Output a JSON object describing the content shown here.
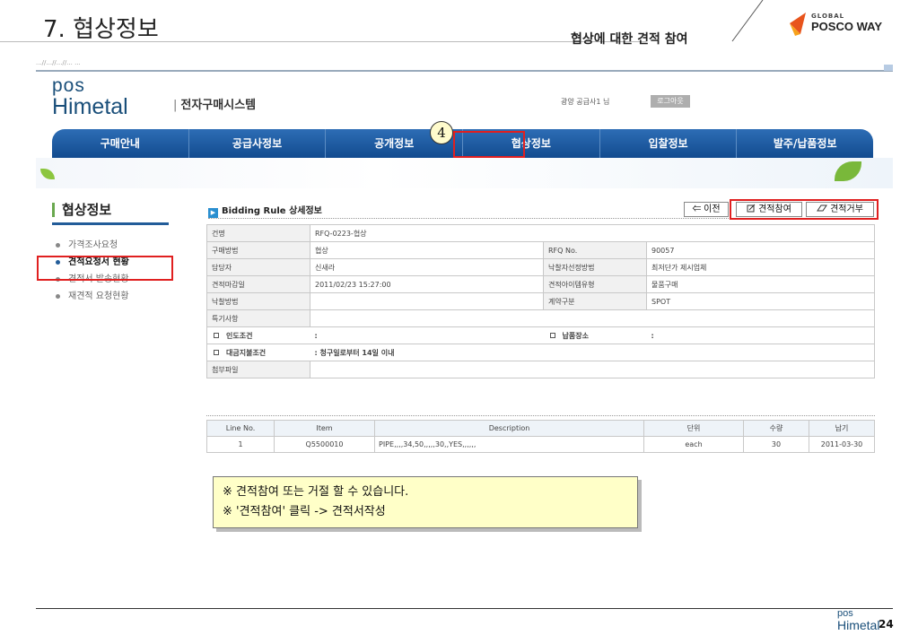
{
  "slide": {
    "title": "7. 협상정보",
    "subtitle": "협상에 대한 견적 참여",
    "brand_global": "GLOBAL",
    "brand_name": "POSCO WAY",
    "page_number": "24",
    "step_badge": "4"
  },
  "url_strip": "...//...//...//... ...",
  "site": {
    "logo_pos": "pos",
    "logo_himetal": "Himetal",
    "system_name": "전자구매시스템",
    "system_bar": "|",
    "user_label": "광양 공급사1 님",
    "logout_label": "로그아웃"
  },
  "nav": {
    "items": [
      "구매안내",
      "공급사정보",
      "공개정보",
      "협상정보",
      "입찰정보",
      "발주/납품정보"
    ],
    "active_index": 3
  },
  "sidebar": {
    "title": "협상정보",
    "items": [
      "가격조사요청",
      "견적요청서 현황",
      "견적서 발송현황",
      "재견적 요청현황"
    ],
    "active_index": 1
  },
  "content": {
    "title": "Bidding Rule 상세정보",
    "title_icon": "▶",
    "buttons": {
      "prev": "⇐ 이전",
      "join": "견적참여",
      "reject": "견적거부"
    },
    "info": {
      "name_label": "건명",
      "name_value": "RFQ-0223-협상",
      "purchase_method_label": "구매방법",
      "purchase_method_value": "협상",
      "rfq_no_label": "RFQ No.",
      "rfq_no_value": "90057",
      "manager_label": "담당자",
      "manager_value": "신새라",
      "award_method_label": "낙찰자선정방법",
      "award_method_value": "최저단가 제시업체",
      "deadline_label": "견적마감일",
      "deadline_value": "2011/02/23 15:27:00",
      "item_type_label": "견적아이템유형",
      "item_type_value": "물품구매",
      "bid_method_label": "낙찰방법",
      "bid_method_value": "",
      "contract_type_label": "계약구분",
      "contract_type_value": "SPOT",
      "special_label": "특기사항",
      "special_value": "",
      "delivery_cond_label": "인도조건",
      "delivery_cond_value": ":",
      "delivery_place_label": "납품장소",
      "delivery_place_value": ":",
      "payment_label": "대금지불조건",
      "payment_value": ": 청구일로부터 14일 이내",
      "attachment_label": "첨부파일",
      "attachment_value": ""
    },
    "lines": {
      "headers": [
        "Line No.",
        "Item",
        "Description",
        "단위",
        "수량",
        "납기"
      ],
      "rows": [
        [
          "1",
          "Q5500010",
          "PIPE,,,,34,50,,,,,30,,YES,,,,,,",
          "each",
          "30",
          "2011-03-30"
        ]
      ]
    }
  },
  "note": {
    "line1": "※ 견적참여 또는 거절 할 수 있습니다.",
    "line2": "※ '견적참여' 클릭 -> 견적서작성"
  },
  "colors": {
    "nav_blue": "#124b8f",
    "highlight_red": "#e02020",
    "note_yellow": "#ffffc8"
  }
}
